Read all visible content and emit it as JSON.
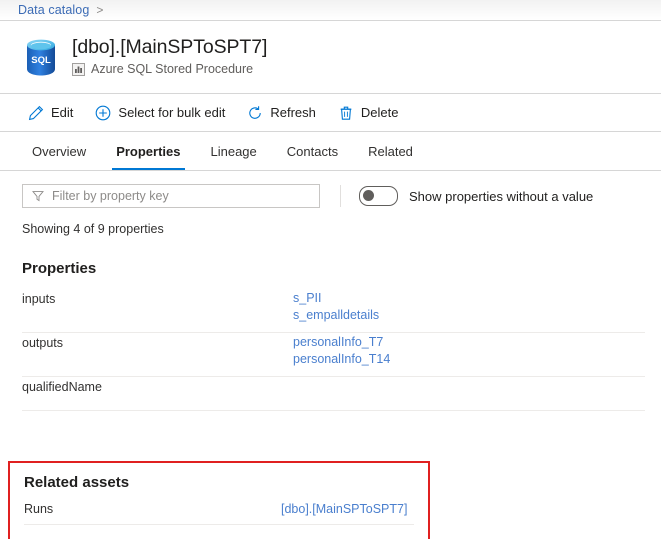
{
  "breadcrumb": {
    "items": [
      {
        "label": "Data catalog",
        "separator": ">"
      }
    ]
  },
  "asset": {
    "icon": "azure-sql-database-icon",
    "title": "[dbo].[MainSPToSPT7]",
    "type_icon": "asset-type-icon",
    "type_label": "Azure SQL Stored Procedure"
  },
  "command_bar": {
    "commands": [
      {
        "icon": "pencil-icon",
        "label": "Edit"
      },
      {
        "icon": "circle-plus-icon",
        "label": "Select for bulk edit"
      },
      {
        "icon": "refresh-icon",
        "label": "Refresh"
      },
      {
        "icon": "trash-icon",
        "label": "Delete"
      }
    ]
  },
  "tabs": [
    {
      "label": "Overview",
      "selected": false
    },
    {
      "label": "Properties",
      "selected": true
    },
    {
      "label": "Lineage",
      "selected": false
    },
    {
      "label": "Contacts",
      "selected": false
    },
    {
      "label": "Related",
      "selected": false
    }
  ],
  "filter": {
    "icon": "filter-icon",
    "placeholder": "Filter by property key",
    "value": ""
  },
  "toggle": {
    "label": "Show properties without a value",
    "state": "off"
  },
  "showing_text": "Showing 4 of 9 properties",
  "properties_section": {
    "heading": "Properties",
    "rows": [
      {
        "key": "inputs",
        "values": [
          "s_PII",
          "s_empalldetails"
        ]
      },
      {
        "key": "outputs",
        "values": [
          "personalInfo_T7",
          "personalInfo_T14"
        ]
      },
      {
        "key": "qualifiedName",
        "values": []
      }
    ]
  },
  "related_assets": {
    "heading": "Related assets",
    "rows": [
      {
        "key": "Runs",
        "value": "[dbo].[MainSPToSPT7]"
      }
    ]
  },
  "colors": {
    "link": "#4a7fce",
    "breadcrumb_link": "#3b6bb5",
    "accent": "#0078d4",
    "highlight_border": "#e02020",
    "divider": "#edebe9"
  }
}
